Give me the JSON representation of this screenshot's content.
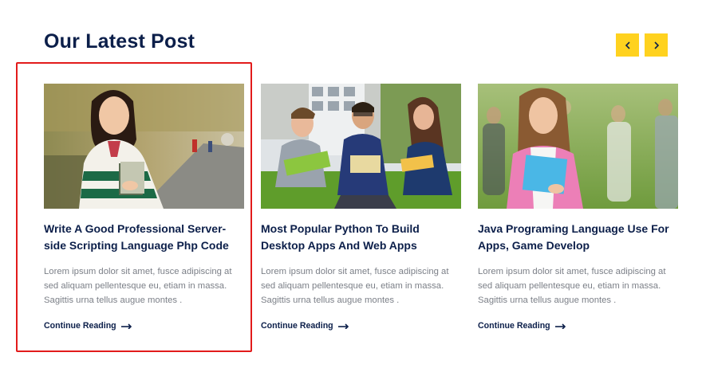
{
  "section": {
    "title": "Our Latest Post"
  },
  "nav": {
    "prev_icon": "chevron-left-icon",
    "next_icon": "chevron-right-icon",
    "accent": "#ffd21f"
  },
  "posts": [
    {
      "title": "Write A Good Professional Server-side Scripting Language Php Code",
      "excerpt": "Lorem ipsum dolor sit amet, fusce adipiscing at sed aliquam pellentesque eu, etiam in massa. Sagittis urna tellus augue montes .",
      "link_label": "Continue Reading",
      "image": "student-girl-holding-books-photo"
    },
    {
      "title": "Most Popular Python To Build Desktop Apps And Web Apps",
      "excerpt": "Lorem ipsum dolor sit amet, fusce adipiscing at sed aliquam pellentesque eu, etiam in massa. Sagittis urna tellus augue montes .",
      "link_label": "Continue Reading",
      "image": "students-studying-on-grass-photo"
    },
    {
      "title": "Java Programing Language Use For Apps, Game Develop",
      "excerpt": "Lorem ipsum dolor sit amet, fusce adipiscing at sed aliquam pellentesque eu, etiam in massa. Sagittis urna tellus augue montes .",
      "link_label": "Continue Reading",
      "image": "smiling-student-with-folders-photo"
    }
  ],
  "colors": {
    "heading": "#0c1f4a",
    "body_text": "#7b7f87",
    "highlight": "#e21b1b"
  }
}
